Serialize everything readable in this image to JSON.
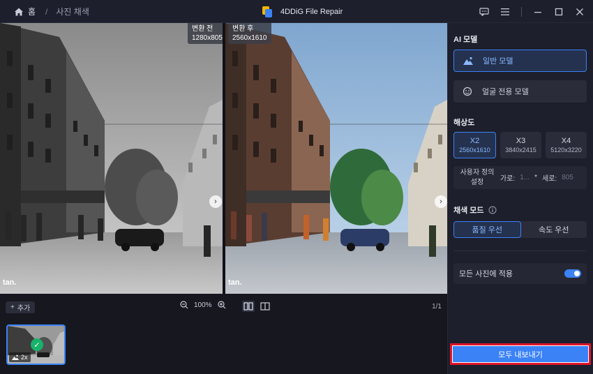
{
  "titlebar": {
    "home_label": "홈",
    "separator": "/",
    "breadcrumb": "사진 채색",
    "app_name": "4DDiG File Repair",
    "icons": [
      "feedback-icon",
      "menu-icon",
      "minimize-icon",
      "maximize-icon",
      "close-icon"
    ]
  },
  "preview": {
    "before_label": "변환 전",
    "before_size": "1280x805",
    "after_label": "변환 후",
    "after_size": "2560x1610",
    "watermark": "tan.",
    "add_label": "추가",
    "zoom": "100%",
    "pager": "1/1"
  },
  "thumbnail": {
    "scale_badge": "2x"
  },
  "panel": {
    "ai_model_title": "AI 모델",
    "model_general": "일반 모델",
    "model_face": "얼굴 전용 모델",
    "resolution_title": "해상도",
    "resolutions": [
      {
        "label": "X2",
        "size": "2560x1610"
      },
      {
        "label": "X3",
        "size": "3840x2415"
      },
      {
        "label": "X4",
        "size": "5120x3220"
      }
    ],
    "custom_label": "사용자 정의 설정",
    "width_label": "가로:",
    "width_value": "1...",
    "times": "*",
    "height_label": "세로:",
    "height_value": "805",
    "color_mode_title": "채색 모드",
    "mode_quality": "품질 우선",
    "mode_speed": "속도 우선",
    "apply_all": "모든 사진에 적용",
    "export_all": "모두 내보내기"
  },
  "colors": {
    "accent": "#3b82f6",
    "highlight": "#e0142a",
    "panel_bg": "#1d1f2c"
  }
}
